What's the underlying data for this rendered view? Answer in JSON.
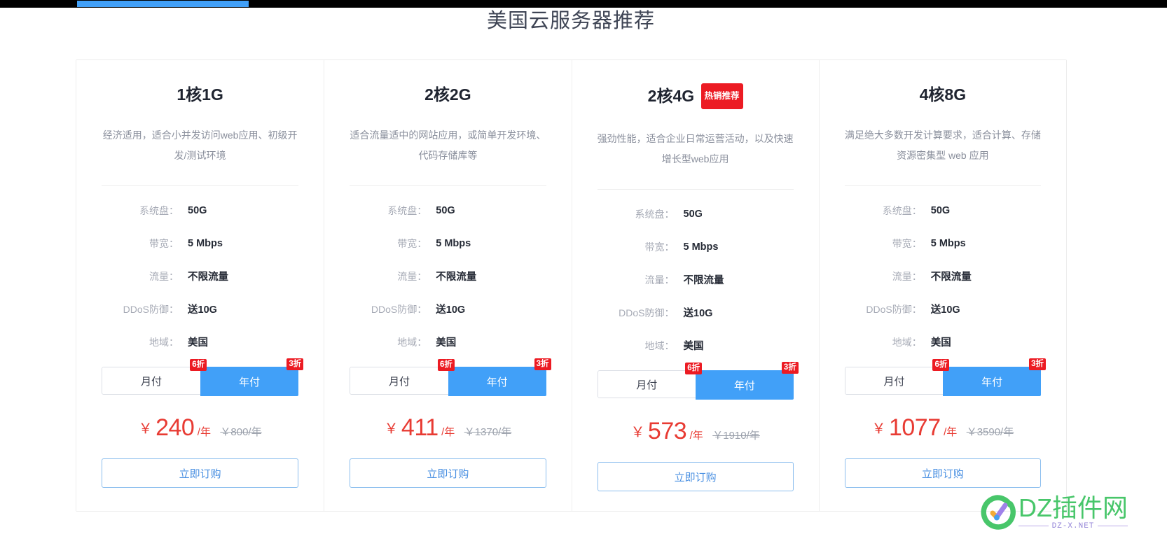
{
  "theme": {
    "accent_blue": "#41a0f8",
    "badge_red": "#ec1b23",
    "price_red": "#e83b33",
    "label_gray": "#a7abb6",
    "border_gray": "#ececec",
    "watermark_green": "#3fc463",
    "watermark_purple": "#8f7fd6"
  },
  "page": {
    "title": "美国云服务器推荐"
  },
  "spec_labels": {
    "system_disk": "系统盘：",
    "bandwidth": "带宽：",
    "traffic": "流量：",
    "ddos": "DDoS防御：",
    "region": "地域："
  },
  "billing": {
    "monthly_label": "月付",
    "yearly_label": "年付",
    "monthly_discount": "6折",
    "yearly_discount": "3折",
    "selected": "年付"
  },
  "order_button_label": "立即订购",
  "cards": [
    {
      "title": "1核1G",
      "hot_badge": "",
      "desc": "经济适用，适合小并发访问web应用、初级开发/测试环境",
      "specs": {
        "system_disk": "50G",
        "bandwidth": "5 Mbps",
        "traffic": "不限流量",
        "ddos": "送10G",
        "region": "美国"
      },
      "price": {
        "currency": "￥",
        "amount": "240",
        "unit": "/年",
        "original": "￥800/年"
      }
    },
    {
      "title": "2核2G",
      "hot_badge": "",
      "desc": "适合流量适中的网站应用，或简单开发环境、代码存储库等",
      "specs": {
        "system_disk": "50G",
        "bandwidth": "5 Mbps",
        "traffic": "不限流量",
        "ddos": "送10G",
        "region": "美国"
      },
      "price": {
        "currency": "￥",
        "amount": "411",
        "unit": "/年",
        "original": "￥1370/年"
      }
    },
    {
      "title": "2核4G",
      "hot_badge": "热销推荐",
      "desc": "强劲性能，适合企业日常运营活动，以及快速增长型web应用",
      "specs": {
        "system_disk": "50G",
        "bandwidth": "5 Mbps",
        "traffic": "不限流量",
        "ddos": "送10G",
        "region": "美国"
      },
      "price": {
        "currency": "￥",
        "amount": "573",
        "unit": "/年",
        "original": "￥1910/年"
      }
    },
    {
      "title": "4核8G",
      "hot_badge": "",
      "desc": "满足绝大多数开发计算要求，适合计算、存储资源密集型 web 应用",
      "specs": {
        "system_disk": "50G",
        "bandwidth": "5 Mbps",
        "traffic": "不限流量",
        "ddos": "送10G",
        "region": "美国"
      },
      "price": {
        "currency": "￥",
        "amount": "1077",
        "unit": "/年",
        "original": "￥3590/年"
      }
    }
  ],
  "watermark": {
    "name": "DZ插件网",
    "domain": "DZ-X.NET",
    "logo_icon": "check-circle-icon"
  }
}
